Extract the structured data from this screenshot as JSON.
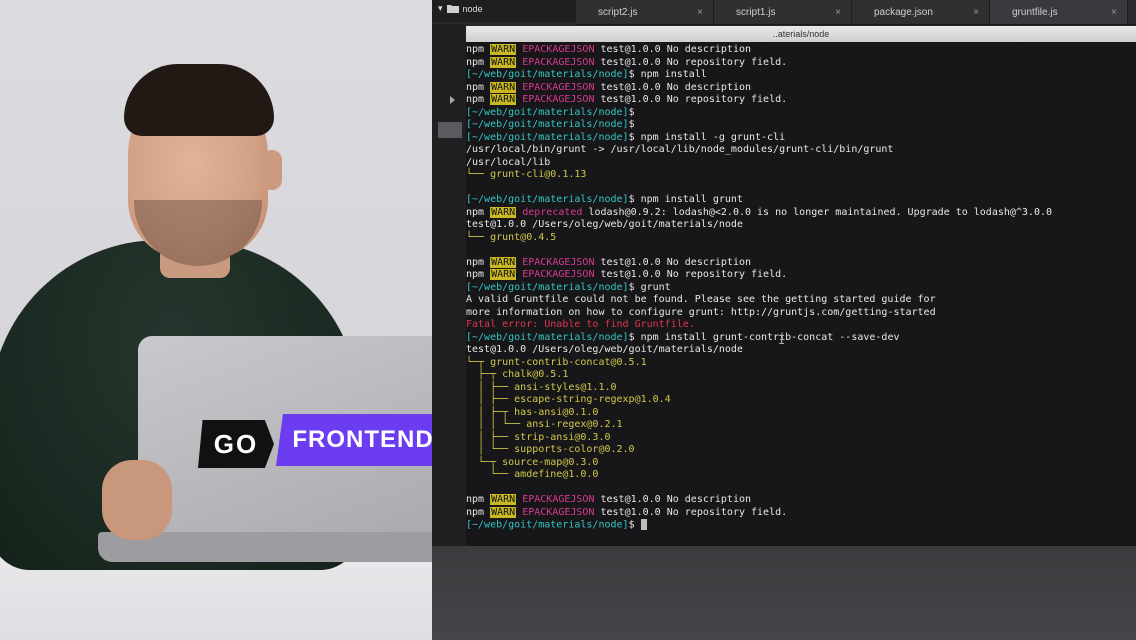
{
  "video": {
    "logo_go": "GO",
    "logo_frontend": "FRONTEND"
  },
  "sidebar": {
    "folder": "node"
  },
  "tabs": [
    {
      "label": "script2.js",
      "close": "×"
    },
    {
      "label": "script1.js",
      "close": "×"
    },
    {
      "label": "package.json",
      "close": "×"
    },
    {
      "label": "gruntfile.js",
      "close": "×"
    }
  ],
  "terminal": {
    "title": "..aterials/node",
    "lines": [
      {
        "parts": [
          {
            "t": "npm ",
            "c": ""
          },
          {
            "t": "WARN",
            "c": "warn"
          },
          {
            "t": " ",
            "c": ""
          },
          {
            "t": "EPACKAGEJSON",
            "c": "pink"
          },
          {
            "t": " test@1.0.0 No description",
            "c": ""
          }
        ]
      },
      {
        "parts": [
          {
            "t": "npm ",
            "c": ""
          },
          {
            "t": "WARN",
            "c": "warn"
          },
          {
            "t": " ",
            "c": ""
          },
          {
            "t": "EPACKAGEJSON",
            "c": "pink"
          },
          {
            "t": " test@1.0.0 No repository field.",
            "c": ""
          }
        ]
      },
      {
        "parts": [
          {
            "t": "[~/web/goit/materials/node]",
            "c": "prompt"
          },
          {
            "t": "$ npm install",
            "c": ""
          }
        ]
      },
      {
        "parts": [
          {
            "t": "npm ",
            "c": ""
          },
          {
            "t": "WARN",
            "c": "warn"
          },
          {
            "t": " ",
            "c": ""
          },
          {
            "t": "EPACKAGEJSON",
            "c": "pink"
          },
          {
            "t": " test@1.0.0 No description",
            "c": ""
          }
        ]
      },
      {
        "parts": [
          {
            "t": "npm ",
            "c": ""
          },
          {
            "t": "WARN",
            "c": "warn"
          },
          {
            "t": " ",
            "c": ""
          },
          {
            "t": "EPACKAGEJSON",
            "c": "pink"
          },
          {
            "t": " test@1.0.0 No repository field.",
            "c": ""
          }
        ]
      },
      {
        "parts": [
          {
            "t": "[~/web/goit/materials/node]",
            "c": "prompt"
          },
          {
            "t": "$",
            "c": ""
          }
        ]
      },
      {
        "parts": [
          {
            "t": "[~/web/goit/materials/node]",
            "c": "prompt"
          },
          {
            "t": "$",
            "c": ""
          }
        ]
      },
      {
        "parts": [
          {
            "t": "[~/web/goit/materials/node]",
            "c": "prompt"
          },
          {
            "t": "$ npm install -g grunt-cli",
            "c": ""
          }
        ]
      },
      {
        "parts": [
          {
            "t": "/usr/local/bin/grunt -> /usr/local/lib/node_modules/grunt-cli/bin/grunt",
            "c": ""
          }
        ]
      },
      {
        "parts": [
          {
            "t": "/usr/local/lib",
            "c": ""
          }
        ]
      },
      {
        "parts": [
          {
            "t": "└── grunt-cli@0.1.13",
            "c": "tree-out"
          }
        ]
      },
      {
        "parts": [
          {
            "t": "",
            "c": ""
          }
        ]
      },
      {
        "parts": [
          {
            "t": "[~/web/goit/materials/node]",
            "c": "prompt"
          },
          {
            "t": "$ npm install grunt",
            "c": ""
          }
        ]
      },
      {
        "parts": [
          {
            "t": "npm ",
            "c": ""
          },
          {
            "t": "WARN",
            "c": "warn"
          },
          {
            "t": " ",
            "c": ""
          },
          {
            "t": "deprecated",
            "c": "pink"
          },
          {
            "t": " lodash@0.9.2: lodash@<2.0.0 is no longer maintained. Upgrade to lodash@^3.0.0",
            "c": ""
          }
        ]
      },
      {
        "parts": [
          {
            "t": "test@1.0.0 /Users/oleg/web/goit/materials/node",
            "c": ""
          }
        ]
      },
      {
        "parts": [
          {
            "t": "└── grunt@0.4.5",
            "c": "tree-out"
          }
        ]
      },
      {
        "parts": [
          {
            "t": "",
            "c": ""
          }
        ]
      },
      {
        "parts": [
          {
            "t": "npm ",
            "c": ""
          },
          {
            "t": "WARN",
            "c": "warn"
          },
          {
            "t": " ",
            "c": ""
          },
          {
            "t": "EPACKAGEJSON",
            "c": "pink"
          },
          {
            "t": " test@1.0.0 No description",
            "c": ""
          }
        ]
      },
      {
        "parts": [
          {
            "t": "npm ",
            "c": ""
          },
          {
            "t": "WARN",
            "c": "warn"
          },
          {
            "t": " ",
            "c": ""
          },
          {
            "t": "EPACKAGEJSON",
            "c": "pink"
          },
          {
            "t": " test@1.0.0 No repository field.",
            "c": ""
          }
        ]
      },
      {
        "parts": [
          {
            "t": "[~/web/goit/materials/node]",
            "c": "prompt"
          },
          {
            "t": "$ grunt",
            "c": ""
          }
        ]
      },
      {
        "parts": [
          {
            "t": "A valid Gruntfile could not be found. Please see the getting started guide for",
            "c": ""
          }
        ]
      },
      {
        "parts": [
          {
            "t": "more information on how to configure grunt: http://gruntjs.com/getting-started",
            "c": ""
          }
        ]
      },
      {
        "parts": [
          {
            "t": "Fatal error: Unable to find Gruntfile.",
            "c": "err"
          }
        ]
      },
      {
        "parts": [
          {
            "t": "[~/web/goit/materials/node]",
            "c": "prompt"
          },
          {
            "t": "$ npm install grunt-contrib-concat --save-dev",
            "c": ""
          }
        ]
      },
      {
        "parts": [
          {
            "t": "test@1.0.0 /Users/oleg/web/goit/materials/node",
            "c": ""
          }
        ]
      },
      {
        "parts": [
          {
            "t": "└─┬ grunt-contrib-concat@0.5.1",
            "c": "tree-out"
          }
        ]
      },
      {
        "parts": [
          {
            "t": "  ├─┬ chalk@0.5.1",
            "c": "tree-out"
          }
        ]
      },
      {
        "parts": [
          {
            "t": "  │ ├── ansi-styles@1.1.0",
            "c": "tree-out"
          }
        ]
      },
      {
        "parts": [
          {
            "t": "  │ ├── escape-string-regexp@1.0.4",
            "c": "tree-out"
          }
        ]
      },
      {
        "parts": [
          {
            "t": "  │ ├─┬ has-ansi@0.1.0",
            "c": "tree-out"
          }
        ]
      },
      {
        "parts": [
          {
            "t": "  │ │ └── ansi-regex@0.2.1",
            "c": "tree-out"
          }
        ]
      },
      {
        "parts": [
          {
            "t": "  │ ├── strip-ansi@0.3.0",
            "c": "tree-out"
          }
        ]
      },
      {
        "parts": [
          {
            "t": "  │ └── supports-color@0.2.0",
            "c": "tree-out"
          }
        ]
      },
      {
        "parts": [
          {
            "t": "  └─┬ source-map@0.3.0",
            "c": "tree-out"
          }
        ]
      },
      {
        "parts": [
          {
            "t": "    └── amdefine@1.0.0",
            "c": "tree-out"
          }
        ]
      },
      {
        "parts": [
          {
            "t": "",
            "c": ""
          }
        ]
      },
      {
        "parts": [
          {
            "t": "npm ",
            "c": ""
          },
          {
            "t": "WARN",
            "c": "warn"
          },
          {
            "t": " ",
            "c": ""
          },
          {
            "t": "EPACKAGEJSON",
            "c": "pink"
          },
          {
            "t": " test@1.0.0 No description",
            "c": ""
          }
        ]
      },
      {
        "parts": [
          {
            "t": "npm ",
            "c": ""
          },
          {
            "t": "WARN",
            "c": "warn"
          },
          {
            "t": " ",
            "c": ""
          },
          {
            "t": "EPACKAGEJSON",
            "c": "pink"
          },
          {
            "t": " test@1.0.0 No repository field.",
            "c": ""
          }
        ]
      },
      {
        "parts": [
          {
            "t": "[~/web/goit/materials/node]",
            "c": "prompt"
          },
          {
            "t": "$ ",
            "c": ""
          }
        ],
        "cursor": true
      }
    ]
  }
}
